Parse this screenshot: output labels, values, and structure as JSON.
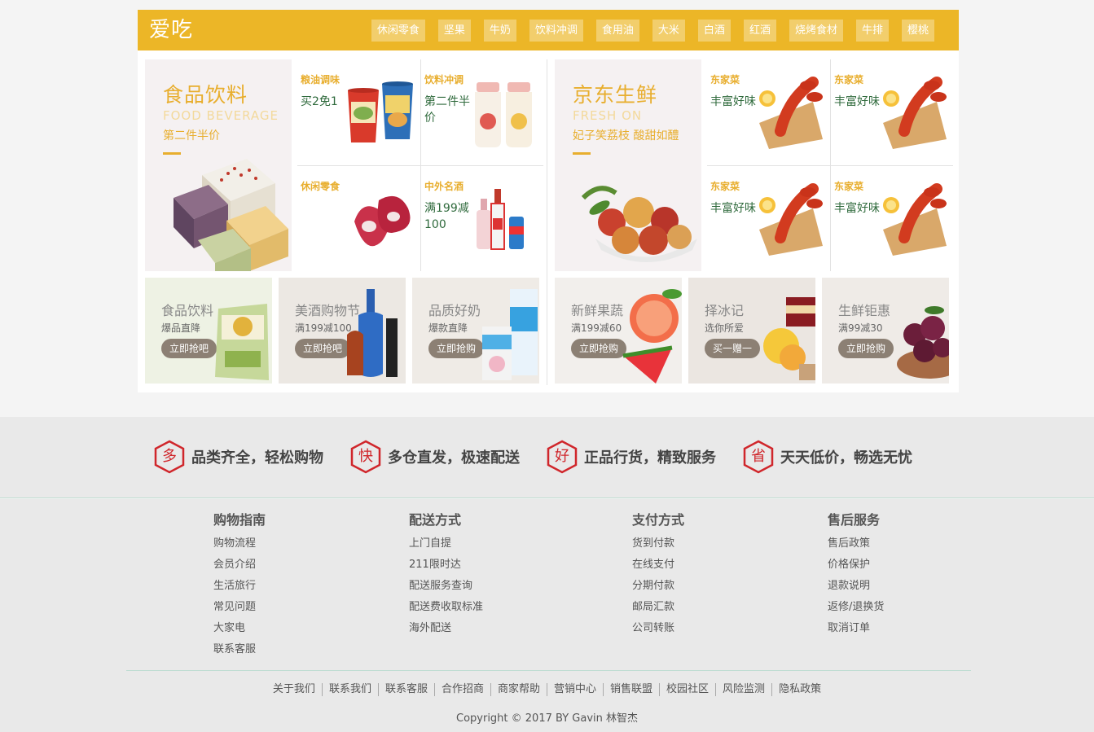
{
  "header": {
    "brand": "爱吃",
    "tags": [
      "休闲零食",
      "坚果",
      "牛奶",
      "饮料冲调",
      "食用油",
      "大米",
      "白酒",
      "红酒",
      "烧烤食材",
      "牛排",
      "樱桃"
    ]
  },
  "left_hero": {
    "title": "食品饮料",
    "subtitle_en": "FOOD BEVERAGE",
    "tagline": "第二件半价"
  },
  "left_cells": [
    {
      "category": "粮油调味",
      "desc": "买2免1"
    },
    {
      "category": "饮料冲调",
      "desc": "第二件半价"
    },
    {
      "category": "休闲零食",
      "desc": ""
    },
    {
      "category": "中外名酒",
      "desc": "满199减100"
    }
  ],
  "right_hero": {
    "title": "京东生鲜",
    "subtitle_en": "FRESH ON",
    "tagline": "妃子笑荔枝 酸甜如醴"
  },
  "right_cells": [
    {
      "category": "东家菜",
      "desc": "丰富好味"
    },
    {
      "category": "东家菜",
      "desc": "丰富好味"
    },
    {
      "category": "东家菜",
      "desc": "丰富好味"
    },
    {
      "category": "东家菜",
      "desc": "丰富好味"
    }
  ],
  "promos": [
    {
      "title": "食品饮料",
      "sub": "爆品直降",
      "btn": "立即抢吧"
    },
    {
      "title": "美酒购物节",
      "sub": "满199减100",
      "btn": "立即抢吧"
    },
    {
      "title": "品质好奶",
      "sub": "爆款直降",
      "btn": "立即抢购"
    },
    {
      "title": "新鲜果蔬",
      "sub": "满199减60",
      "btn": "立即抢购"
    },
    {
      "title": "择冰记",
      "sub": "选你所爱",
      "btn": "买一赠一"
    },
    {
      "title": "生鲜钜惠",
      "sub": "满99减30",
      "btn": "立即抢购"
    }
  ],
  "services": [
    {
      "icon": "多",
      "text": "品类齐全，轻松购物"
    },
    {
      "icon": "快",
      "text": "多仓直发，极速配送"
    },
    {
      "icon": "好",
      "text": "正品行货，精致服务"
    },
    {
      "icon": "省",
      "text": "天天低价，畅选无忧"
    }
  ],
  "footer": {
    "columns": [
      {
        "title": "购物指南",
        "links": [
          "购物流程",
          "会员介绍",
          "生活旅行",
          "常见问题",
          "大家电",
          "联系客服"
        ]
      },
      {
        "title": "配送方式",
        "links": [
          "上门自提",
          "211限时达",
          "配送服务查询",
          "配送费收取标准",
          "海外配送"
        ]
      },
      {
        "title": "支付方式",
        "links": [
          "货到付款",
          "在线支付",
          "分期付款",
          "邮局汇款",
          "公司转账"
        ]
      },
      {
        "title": "售后服务",
        "links": [
          "售后政策",
          "价格保护",
          "退款说明",
          "返修/退换货",
          "取消订单"
        ]
      }
    ],
    "bottom_links": [
      "关于我们",
      "联系我们",
      "联系客服",
      "合作招商",
      "商家帮助",
      "营销中心",
      "销售联盟",
      "校园社区",
      "风险监测",
      "隐私政策"
    ],
    "copyright": "Copyright © 2017 BY Gavin 林智杰"
  },
  "colors": {
    "accent": "#ecb627",
    "tag_bg": "#f2ce6c",
    "service_red": "#d0262b",
    "desc_green": "#2f6a3c"
  }
}
